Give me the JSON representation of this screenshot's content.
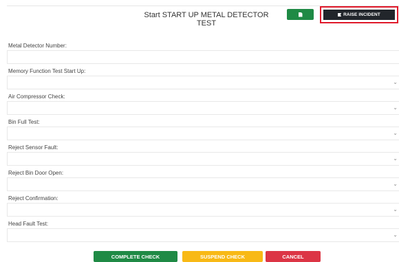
{
  "header": {
    "title": "Start START UP METAL DETECTOR TEST",
    "doc_button_icon": "document-icon",
    "raise_incident_label": "RAISE INCIDENT"
  },
  "fields": [
    {
      "label": "Metal Detector Number:",
      "type": "text",
      "value": ""
    },
    {
      "label": "Memory Function Test Start Up:",
      "type": "select",
      "value": ""
    },
    {
      "label": "Air Compressor Check:",
      "type": "select",
      "value": ""
    },
    {
      "label": "Bin Full Test:",
      "type": "select",
      "value": ""
    },
    {
      "label": "Reject Sensor Fault:",
      "type": "select",
      "value": ""
    },
    {
      "label": "Reject Bin Door Open:",
      "type": "select",
      "value": ""
    },
    {
      "label": "Reject Confirmation:",
      "type": "select",
      "value": ""
    },
    {
      "label": "Head Fault Test:",
      "type": "select",
      "value": ""
    }
  ],
  "actions": {
    "complete": "COMPLETE CHECK",
    "suspend": "SUSPEND CHECK",
    "cancel": "CANCEL"
  },
  "colors": {
    "complete": "#1f8a45",
    "suspend": "#f8b916",
    "cancel": "#dc3545",
    "raise": "#22262b",
    "highlight": "#e0192a"
  }
}
